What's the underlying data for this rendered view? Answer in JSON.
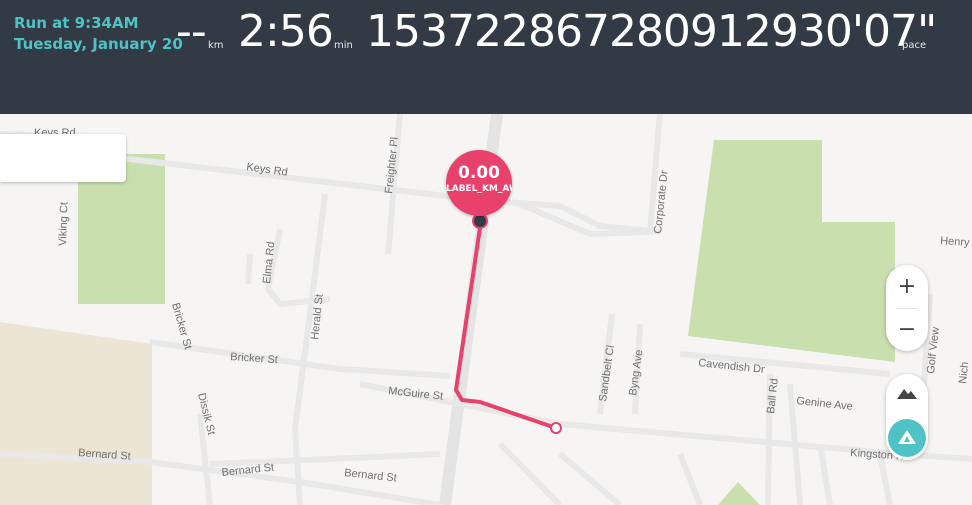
{
  "header": {
    "run_title": "Run at 9:34AM",
    "run_date": "Tuesday, January 20",
    "distance": {
      "value": "--",
      "unit": "km"
    },
    "duration": {
      "value": "2:56",
      "unit": "min"
    },
    "pace": {
      "value": "15372286728091293​0'07\"",
      "unit": "pace"
    }
  },
  "map": {
    "km_marker": {
      "value": "0.00",
      "label": "LABEL_KM_AWAY"
    },
    "streets": [
      "Keys Rd",
      "Keys Rd",
      "Viking Ct",
      "Freighter Pl",
      "Corporate Dr",
      "Henry",
      "Elma Rd",
      "Herald St",
      "Bricker St",
      "Bricker St",
      "McGuire St",
      "Dissik St",
      "Sandbelt Cl",
      "Byng Ave",
      "Cavendish Dr",
      "Ball Rd",
      "Genine Ave",
      "Golf View",
      "Nich",
      "Bernard St",
      "Bernard St",
      "Bernard St",
      "Kingston Rd"
    ],
    "controls": {
      "zoom_in": "+",
      "zoom_out": "−"
    },
    "colors": {
      "route": "#e8416c",
      "accent": "#4fc2c5",
      "header_bg": "#323a45",
      "park": "#c9dfae"
    }
  }
}
